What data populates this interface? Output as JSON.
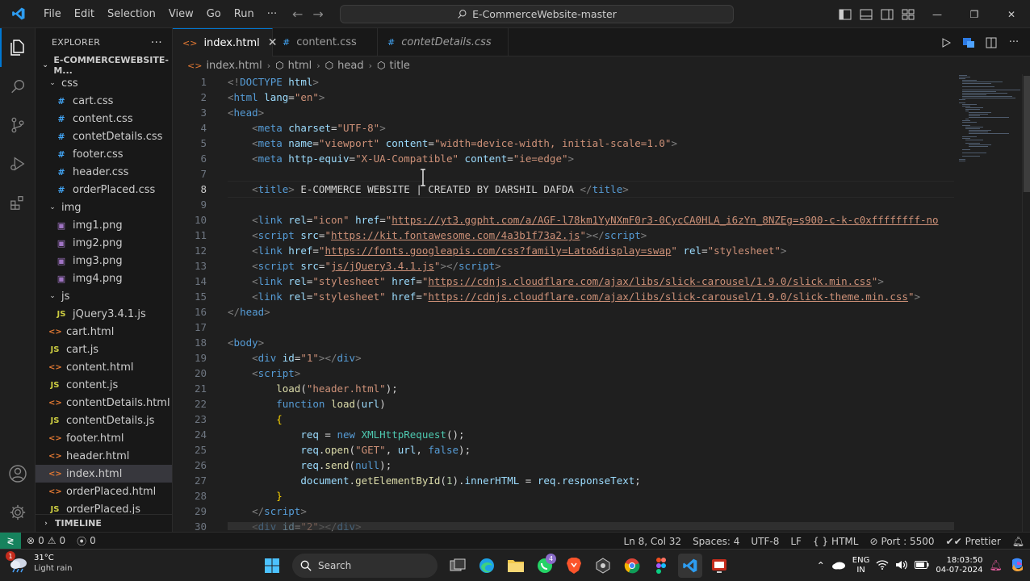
{
  "titlebar": {
    "menu": [
      "File",
      "Edit",
      "Selection",
      "View",
      "Go",
      "Run",
      "···"
    ],
    "search_text": "E-CommerceWebsite-master"
  },
  "sidebar": {
    "header": "EXPLORER",
    "root": "E-COMMERCEWEBSITE-M...",
    "timeline": "TIMELINE",
    "items": [
      {
        "label": "css",
        "kind": "folder",
        "depth": 1
      },
      {
        "label": "cart.css",
        "kind": "css",
        "depth": 2
      },
      {
        "label": "content.css",
        "kind": "css",
        "depth": 2
      },
      {
        "label": "contetDetails.css",
        "kind": "css",
        "depth": 2
      },
      {
        "label": "footer.css",
        "kind": "css",
        "depth": 2
      },
      {
        "label": "header.css",
        "kind": "css",
        "depth": 2
      },
      {
        "label": "orderPlaced.css",
        "kind": "css",
        "depth": 2
      },
      {
        "label": "img",
        "kind": "folder",
        "depth": 1
      },
      {
        "label": "img1.png",
        "kind": "img",
        "depth": 2
      },
      {
        "label": "img2.png",
        "kind": "img",
        "depth": 2
      },
      {
        "label": "img3.png",
        "kind": "img",
        "depth": 2
      },
      {
        "label": "img4.png",
        "kind": "img",
        "depth": 2
      },
      {
        "label": "js",
        "kind": "folder",
        "depth": 1
      },
      {
        "label": "jQuery3.4.1.js",
        "kind": "js",
        "depth": 2
      },
      {
        "label": "cart.html",
        "kind": "html",
        "depth": 1
      },
      {
        "label": "cart.js",
        "kind": "js",
        "depth": 1
      },
      {
        "label": "content.html",
        "kind": "html",
        "depth": 1
      },
      {
        "label": "content.js",
        "kind": "js",
        "depth": 1
      },
      {
        "label": "contentDetails.html",
        "kind": "html",
        "depth": 1
      },
      {
        "label": "contentDetails.js",
        "kind": "js",
        "depth": 1
      },
      {
        "label": "footer.html",
        "kind": "html",
        "depth": 1
      },
      {
        "label": "header.html",
        "kind": "html",
        "depth": 1
      },
      {
        "label": "index.html",
        "kind": "html",
        "depth": 1,
        "selected": true
      },
      {
        "label": "orderPlaced.html",
        "kind": "html",
        "depth": 1
      },
      {
        "label": "orderPlaced.js",
        "kind": "js",
        "depth": 1
      }
    ]
  },
  "tabs": [
    {
      "label": "index.html",
      "icon": "<>",
      "active": true,
      "italic": false
    },
    {
      "label": "content.css",
      "icon": "#",
      "active": false,
      "italic": false
    },
    {
      "label": "contetDetails.css",
      "icon": "#",
      "active": false,
      "italic": true
    }
  ],
  "breadcrumb": [
    "index.html",
    "html",
    "head",
    "title"
  ],
  "editor": {
    "current_line": 8,
    "lines": [
      [
        [
          "p",
          "<!"
        ],
        [
          "t",
          "DOCTYPE"
        ],
        [
          "x",
          " "
        ],
        [
          "a",
          "html"
        ],
        [
          "p",
          ">"
        ]
      ],
      [
        [
          "p",
          "<"
        ],
        [
          "t",
          "html"
        ],
        [
          "x",
          " "
        ],
        [
          "a",
          "lang"
        ],
        [
          "x",
          "="
        ],
        [
          "s",
          "\"en\""
        ],
        [
          "p",
          ">"
        ]
      ],
      [
        [
          "p",
          "<"
        ],
        [
          "t",
          "head"
        ],
        [
          "p",
          ">"
        ]
      ],
      [
        [
          "x",
          "    "
        ],
        [
          "p",
          "<"
        ],
        [
          "t",
          "meta"
        ],
        [
          "x",
          " "
        ],
        [
          "a",
          "charset"
        ],
        [
          "x",
          "="
        ],
        [
          "s",
          "\"UTF-8\""
        ],
        [
          "p",
          ">"
        ]
      ],
      [
        [
          "x",
          "    "
        ],
        [
          "p",
          "<"
        ],
        [
          "t",
          "meta"
        ],
        [
          "x",
          " "
        ],
        [
          "a",
          "name"
        ],
        [
          "x",
          "="
        ],
        [
          "s",
          "\"viewport\""
        ],
        [
          "x",
          " "
        ],
        [
          "a",
          "content"
        ],
        [
          "x",
          "="
        ],
        [
          "s",
          "\"width=device-width, initial-scale=1.0\""
        ],
        [
          "p",
          ">"
        ]
      ],
      [
        [
          "x",
          "    "
        ],
        [
          "p",
          "<"
        ],
        [
          "t",
          "meta"
        ],
        [
          "x",
          " "
        ],
        [
          "a",
          "http-equiv"
        ],
        [
          "x",
          "="
        ],
        [
          "s",
          "\"X-UA-Compatible\""
        ],
        [
          "x",
          " "
        ],
        [
          "a",
          "content"
        ],
        [
          "x",
          "="
        ],
        [
          "s",
          "\"ie=edge\""
        ],
        [
          "p",
          ">"
        ]
      ],
      [],
      [
        [
          "x",
          "    "
        ],
        [
          "p",
          "<"
        ],
        [
          "t",
          "title"
        ],
        [
          "p",
          ">"
        ],
        [
          "x",
          " E-COMMERCE WEBSITE | CREATED BY DARSHIL DAFDA "
        ],
        [
          "p",
          "</"
        ],
        [
          "t",
          "title"
        ],
        [
          "p",
          ">"
        ]
      ],
      [],
      [
        [
          "x",
          "    "
        ],
        [
          "p",
          "<"
        ],
        [
          "t",
          "link"
        ],
        [
          "x",
          " "
        ],
        [
          "a",
          "rel"
        ],
        [
          "x",
          "="
        ],
        [
          "s",
          "\"icon\""
        ],
        [
          "x",
          " "
        ],
        [
          "a",
          "href"
        ],
        [
          "x",
          "="
        ],
        [
          "s",
          "\""
        ],
        [
          "u",
          "https://yt3.ggpht.com/a/AGF-l78km1YyNXmF0r3-0CycCA0HLA_i6zYn_8NZEg=s900-c-k-c0xffffffff-no"
        ]
      ],
      [
        [
          "x",
          "    "
        ],
        [
          "p",
          "<"
        ],
        [
          "t",
          "script"
        ],
        [
          "x",
          " "
        ],
        [
          "a",
          "src"
        ],
        [
          "x",
          "="
        ],
        [
          "s",
          "\""
        ],
        [
          "u",
          "https://kit.fontawesome.com/4a3b1f73a2.js"
        ],
        [
          "s",
          "\""
        ],
        [
          "p",
          "></"
        ],
        [
          "t",
          "script"
        ],
        [
          "p",
          ">"
        ]
      ],
      [
        [
          "x",
          "    "
        ],
        [
          "p",
          "<"
        ],
        [
          "t",
          "link"
        ],
        [
          "x",
          " "
        ],
        [
          "a",
          "href"
        ],
        [
          "x",
          "="
        ],
        [
          "s",
          "\""
        ],
        [
          "u",
          "https://fonts.googleapis.com/css?family=Lato&display=swap"
        ],
        [
          "s",
          "\""
        ],
        [
          "x",
          " "
        ],
        [
          "a",
          "rel"
        ],
        [
          "x",
          "="
        ],
        [
          "s",
          "\"stylesheet\""
        ],
        [
          "p",
          ">"
        ]
      ],
      [
        [
          "x",
          "    "
        ],
        [
          "p",
          "<"
        ],
        [
          "t",
          "script"
        ],
        [
          "x",
          " "
        ],
        [
          "a",
          "src"
        ],
        [
          "x",
          "="
        ],
        [
          "s",
          "\""
        ],
        [
          "u",
          "js/jQuery3.4.1.js"
        ],
        [
          "s",
          "\""
        ],
        [
          "p",
          "></"
        ],
        [
          "t",
          "script"
        ],
        [
          "p",
          ">"
        ]
      ],
      [
        [
          "x",
          "    "
        ],
        [
          "p",
          "<"
        ],
        [
          "t",
          "link"
        ],
        [
          "x",
          " "
        ],
        [
          "a",
          "rel"
        ],
        [
          "x",
          "="
        ],
        [
          "s",
          "\"stylesheet\""
        ],
        [
          "x",
          " "
        ],
        [
          "a",
          "href"
        ],
        [
          "x",
          "="
        ],
        [
          "s",
          "\""
        ],
        [
          "u",
          "https://cdnjs.cloudflare.com/ajax/libs/slick-carousel/1.9.0/slick.min.css"
        ],
        [
          "s",
          "\""
        ],
        [
          "p",
          ">"
        ]
      ],
      [
        [
          "x",
          "    "
        ],
        [
          "p",
          "<"
        ],
        [
          "t",
          "link"
        ],
        [
          "x",
          " "
        ],
        [
          "a",
          "rel"
        ],
        [
          "x",
          "="
        ],
        [
          "s",
          "\"stylesheet\""
        ],
        [
          "x",
          " "
        ],
        [
          "a",
          "href"
        ],
        [
          "x",
          "="
        ],
        [
          "s",
          "\""
        ],
        [
          "u",
          "https://cdnjs.cloudflare.com/ajax/libs/slick-carousel/1.9.0/slick-theme.min.css"
        ],
        [
          "s",
          "\""
        ],
        [
          "p",
          ">"
        ]
      ],
      [
        [
          "p",
          "</"
        ],
        [
          "t",
          "head"
        ],
        [
          "p",
          ">"
        ]
      ],
      [],
      [
        [
          "p",
          "<"
        ],
        [
          "t",
          "body"
        ],
        [
          "p",
          ">"
        ]
      ],
      [
        [
          "x",
          "    "
        ],
        [
          "p",
          "<"
        ],
        [
          "t",
          "div"
        ],
        [
          "x",
          " "
        ],
        [
          "a",
          "id"
        ],
        [
          "x",
          "="
        ],
        [
          "s",
          "\"1\""
        ],
        [
          "p",
          "></"
        ],
        [
          "t",
          "div"
        ],
        [
          "p",
          ">"
        ]
      ],
      [
        [
          "x",
          "    "
        ],
        [
          "p",
          "<"
        ],
        [
          "t",
          "script"
        ],
        [
          "p",
          ">"
        ]
      ],
      [
        [
          "x",
          "        "
        ],
        [
          "f",
          "load"
        ],
        [
          "x",
          "("
        ],
        [
          "s",
          "\"header.html\""
        ],
        [
          "x",
          ");"
        ]
      ],
      [
        [
          "x",
          "        "
        ],
        [
          "k",
          "function"
        ],
        [
          "x",
          " "
        ],
        [
          "f",
          "load"
        ],
        [
          "x",
          "("
        ],
        [
          "a",
          "url"
        ],
        [
          "x",
          ")"
        ]
      ],
      [
        [
          "x",
          "        "
        ],
        [
          "b",
          "{"
        ]
      ],
      [
        [
          "x",
          "            "
        ],
        [
          "a",
          "req"
        ],
        [
          "x",
          " = "
        ],
        [
          "k",
          "new"
        ],
        [
          "x",
          " "
        ],
        [
          "c",
          "XMLHttpRequest"
        ],
        [
          "x",
          "();"
        ]
      ],
      [
        [
          "x",
          "            "
        ],
        [
          "a",
          "req"
        ],
        [
          "x",
          "."
        ],
        [
          "f",
          "open"
        ],
        [
          "x",
          "("
        ],
        [
          "s",
          "\"GET\""
        ],
        [
          "x",
          ", "
        ],
        [
          "a",
          "url"
        ],
        [
          "x",
          ", "
        ],
        [
          "k",
          "false"
        ],
        [
          "x",
          ");"
        ]
      ],
      [
        [
          "x",
          "            "
        ],
        [
          "a",
          "req"
        ],
        [
          "x",
          "."
        ],
        [
          "f",
          "send"
        ],
        [
          "x",
          "("
        ],
        [
          "k",
          "null"
        ],
        [
          "x",
          ");"
        ]
      ],
      [
        [
          "x",
          "            "
        ],
        [
          "a",
          "document"
        ],
        [
          "x",
          "."
        ],
        [
          "f",
          "getElementById"
        ],
        [
          "x",
          "("
        ],
        [
          "n",
          "1"
        ],
        [
          "x",
          ")."
        ],
        [
          "a",
          "innerHTML"
        ],
        [
          "x",
          " = "
        ],
        [
          "a",
          "req"
        ],
        [
          "x",
          "."
        ],
        [
          "a",
          "responseText"
        ],
        [
          "x",
          ";"
        ]
      ],
      [
        [
          "x",
          "        "
        ],
        [
          "b",
          "}"
        ]
      ],
      [
        [
          "x",
          "    "
        ],
        [
          "p",
          "</"
        ],
        [
          "t",
          "script"
        ],
        [
          "p",
          ">"
        ]
      ],
      [
        [
          "x",
          "    "
        ],
        [
          "p",
          "<"
        ],
        [
          "t",
          "div"
        ],
        [
          "x",
          " "
        ],
        [
          "a",
          "id"
        ],
        [
          "x",
          "="
        ],
        [
          "s",
          "\"2\""
        ],
        [
          "p",
          "></"
        ],
        [
          "t",
          "div"
        ],
        [
          "p",
          ">"
        ]
      ]
    ]
  },
  "statusbar": {
    "errors": "0",
    "warnings": "0",
    "ports_count": "0",
    "position": "Ln 8, Col 32",
    "spaces": "Spaces: 4",
    "encoding": "UTF-8",
    "eol": "LF",
    "language": "HTML",
    "port": "Port : 5500",
    "prettier": "Prettier"
  },
  "taskbar": {
    "temperature": "31°C",
    "weather": "Light rain",
    "weather_badge": "1",
    "search": "Search",
    "whatsapp_badge": "4",
    "lang_top": "ENG",
    "lang_bottom": "IN",
    "time": "18:03:50",
    "date": "04-07-2024"
  },
  "colors": {
    "accent": "#0078d4",
    "remote": "#16825d",
    "editor_bg": "#1f1f1f"
  }
}
